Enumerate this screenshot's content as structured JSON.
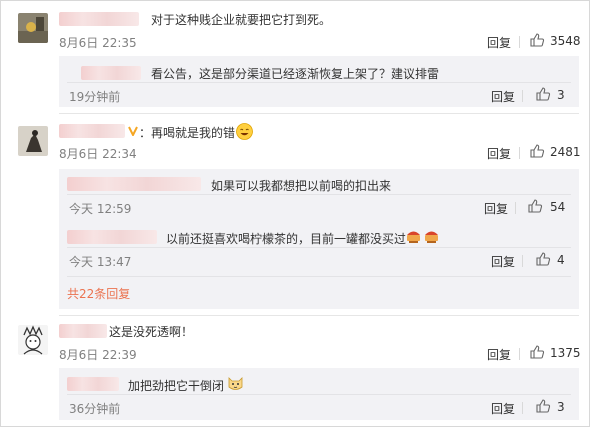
{
  "labels": {
    "reply": "回复"
  },
  "colors": {
    "more_link": "#eb7350",
    "reply_background": "#f2f2f5",
    "verified_badge": "#f5a623"
  },
  "comments": [
    {
      "text": "对于这种贱企业就要把它打到死。",
      "time": "8月6日 22:35",
      "likes": "3548",
      "replies": [
        {
          "text": "看公告，这是部分渠道已经逐渐恢复上架了？建议排雷",
          "time": "19分钟前",
          "likes": "3"
        }
      ]
    },
    {
      "text": "：再喝就是我的错",
      "emoji": "smile-emoji-icon",
      "time": "8月6日 22:34",
      "likes": "2481",
      "replies": [
        {
          "text": "如果可以我都想把以前喝的扣出来",
          "time": "今天 12:59",
          "likes": "54"
        },
        {
          "text": "以前还挺喜欢喝柠檬茶的，目前一罐都没买过",
          "emoji": "drink-emoji-icon",
          "time": "今天 13:47",
          "likes": "4"
        }
      ],
      "more_replies": "共22条回复"
    },
    {
      "text": "这是没死透啊！",
      "time": "8月6日 22:39",
      "likes": "1375",
      "replies": [
        {
          "text": "加把劲把它干倒闭",
          "emoji": "cat-emoji-icon",
          "time": "36分钟前",
          "likes": "3"
        }
      ]
    }
  ]
}
